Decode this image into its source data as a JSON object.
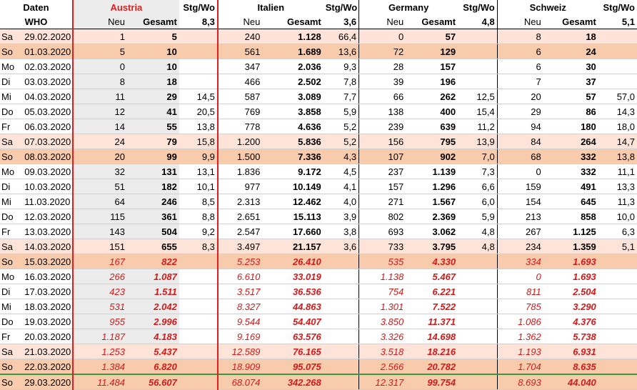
{
  "header": {
    "daten": "Daten",
    "who": "WHO",
    "neu": "Neu",
    "gesamt": "Gesamt",
    "stg": "Stg/Wo",
    "countries": [
      {
        "name": "Austria",
        "stg": "8,3"
      },
      {
        "name": "Italien",
        "stg": "3,6"
      },
      {
        "name": "Germany",
        "stg": "4,8"
      },
      {
        "name": "Schweiz",
        "stg": "5,1"
      }
    ]
  },
  "rows": [
    {
      "day": "Sa",
      "date": "29.02.2020",
      "type": "weekend",
      "c": [
        [
          "1",
          "5",
          ""
        ],
        [
          "240",
          "1.128",
          "66,4"
        ],
        [
          "0",
          "57",
          ""
        ],
        [
          "8",
          "18",
          ""
        ]
      ]
    },
    {
      "day": "So",
      "date": "01.03.2020",
      "type": "weekend2",
      "c": [
        [
          "5",
          "10",
          ""
        ],
        [
          "561",
          "1.689",
          "13,6"
        ],
        [
          "72",
          "129",
          ""
        ],
        [
          "6",
          "24",
          ""
        ]
      ]
    },
    {
      "day": "Mo",
      "date": "02.03.2020",
      "type": "wkstart",
      "c": [
        [
          "0",
          "10",
          ""
        ],
        [
          "347",
          "2.036",
          "9,3"
        ],
        [
          "28",
          "157",
          ""
        ],
        [
          "6",
          "30",
          ""
        ]
      ]
    },
    {
      "day": "Di",
      "date": "03.03.2020",
      "type": "",
      "c": [
        [
          "8",
          "18",
          ""
        ],
        [
          "466",
          "2.502",
          "7,8"
        ],
        [
          "39",
          "196",
          ""
        ],
        [
          "7",
          "37",
          ""
        ]
      ]
    },
    {
      "day": "Mi",
      "date": "04.03.2020",
      "type": "",
      "c": [
        [
          "11",
          "29",
          "14,5"
        ],
        [
          "587",
          "3.089",
          "7,7"
        ],
        [
          "66",
          "262",
          "12,5"
        ],
        [
          "20",
          "57",
          "57,0"
        ]
      ]
    },
    {
      "day": "Do",
      "date": "05.03.2020",
      "type": "",
      "c": [
        [
          "12",
          "41",
          "20,5"
        ],
        [
          "769",
          "3.858",
          "5,9"
        ],
        [
          "138",
          "400",
          "15,4"
        ],
        [
          "29",
          "86",
          "14,3"
        ]
      ]
    },
    {
      "day": "Fr",
      "date": "06.03.2020",
      "type": "",
      "c": [
        [
          "14",
          "55",
          "13,8"
        ],
        [
          "778",
          "4.636",
          "5,2"
        ],
        [
          "239",
          "639",
          "11,2"
        ],
        [
          "94",
          "180",
          "18,0"
        ]
      ]
    },
    {
      "day": "Sa",
      "date": "07.03.2020",
      "type": "weekend",
      "c": [
        [
          "24",
          "79",
          "15,8"
        ],
        [
          "1.200",
          "5.836",
          "5,2"
        ],
        [
          "156",
          "795",
          "13,9"
        ],
        [
          "84",
          "264",
          "14,7"
        ]
      ]
    },
    {
      "day": "So",
      "date": "08.03.2020",
      "type": "weekend2",
      "c": [
        [
          "20",
          "99",
          "9,9"
        ],
        [
          "1.500",
          "7.336",
          "4,3"
        ],
        [
          "107",
          "902",
          "7,0"
        ],
        [
          "68",
          "332",
          "13,8"
        ]
      ]
    },
    {
      "day": "Mo",
      "date": "09.03.2020",
      "type": "wkstart",
      "c": [
        [
          "32",
          "131",
          "13,1"
        ],
        [
          "1.836",
          "9.172",
          "4,5"
        ],
        [
          "237",
          "1.139",
          "7,3"
        ],
        [
          "0",
          "332",
          "11,1"
        ]
      ]
    },
    {
      "day": "Di",
      "date": "10.03.2020",
      "type": "",
      "c": [
        [
          "51",
          "182",
          "10,1"
        ],
        [
          "977",
          "10.149",
          "4,1"
        ],
        [
          "157",
          "1.296",
          "6,6"
        ],
        [
          "159",
          "491",
          "13,3"
        ]
      ]
    },
    {
      "day": "Mi",
      "date": "11.03.2020",
      "type": "",
      "c": [
        [
          "64",
          "246",
          "8,5"
        ],
        [
          "2.313",
          "12.462",
          "4,0"
        ],
        [
          "271",
          "1.567",
          "6,0"
        ],
        [
          "154",
          "645",
          "11,3"
        ]
      ]
    },
    {
      "day": "Do",
      "date": "12.03.2020",
      "type": "",
      "c": [
        [
          "115",
          "361",
          "8,8"
        ],
        [
          "2.651",
          "15.113",
          "3,9"
        ],
        [
          "802",
          "2.369",
          "5,9"
        ],
        [
          "213",
          "858",
          "10,0"
        ]
      ]
    },
    {
      "day": "Fr",
      "date": "13.03.2020",
      "type": "",
      "c": [
        [
          "143",
          "504",
          "9,2"
        ],
        [
          "2.547",
          "17.660",
          "3,8"
        ],
        [
          "693",
          "3.062",
          "4,8"
        ],
        [
          "267",
          "1.125",
          "6,3"
        ]
      ]
    },
    {
      "day": "Sa",
      "date": "14.03.2020",
      "type": "weekend",
      "c": [
        [
          "151",
          "655",
          "8,3"
        ],
        [
          "3.497",
          "21.157",
          "3,6"
        ],
        [
          "733",
          "3.795",
          "4,8"
        ],
        [
          "234",
          "1.359",
          "5,1"
        ]
      ]
    },
    {
      "day": "So",
      "date": "15.03.2020",
      "type": "weekend2 proj",
      "c": [
        [
          "167",
          "822",
          ""
        ],
        [
          "5.253",
          "26.410",
          ""
        ],
        [
          "535",
          "4.330",
          ""
        ],
        [
          "334",
          "1.693",
          ""
        ]
      ]
    },
    {
      "day": "Mo",
      "date": "16.03.2020",
      "type": "wkstart proj",
      "c": [
        [
          "266",
          "1.087",
          ""
        ],
        [
          "6.610",
          "33.019",
          ""
        ],
        [
          "1.138",
          "5.467",
          ""
        ],
        [
          "0",
          "1.693",
          ""
        ]
      ]
    },
    {
      "day": "Di",
      "date": "17.03.2020",
      "type": "proj",
      "c": [
        [
          "423",
          "1.511",
          ""
        ],
        [
          "3.517",
          "36.536",
          ""
        ],
        [
          "754",
          "6.221",
          ""
        ],
        [
          "811",
          "2.504",
          ""
        ]
      ]
    },
    {
      "day": "Mi",
      "date": "18.03.2020",
      "type": "proj",
      "c": [
        [
          "531",
          "2.042",
          ""
        ],
        [
          "8.327",
          "44.863",
          ""
        ],
        [
          "1.301",
          "7.522",
          ""
        ],
        [
          "785",
          "3.290",
          ""
        ]
      ]
    },
    {
      "day": "Do",
      "date": "19.03.2020",
      "type": "proj",
      "c": [
        [
          "955",
          "2.996",
          ""
        ],
        [
          "9.544",
          "54.407",
          ""
        ],
        [
          "3.850",
          "11.371",
          ""
        ],
        [
          "1.086",
          "4.376",
          ""
        ]
      ]
    },
    {
      "day": "Fr",
      "date": "20.03.2020",
      "type": "proj",
      "c": [
        [
          "1.187",
          "4.183",
          ""
        ],
        [
          "9.169",
          "63.576",
          ""
        ],
        [
          "3.326",
          "14.698",
          ""
        ],
        [
          "1.362",
          "5.738",
          ""
        ]
      ]
    },
    {
      "day": "Sa",
      "date": "21.03.2020",
      "type": "weekend proj",
      "c": [
        [
          "1.253",
          "5.437",
          ""
        ],
        [
          "12.589",
          "76.165",
          ""
        ],
        [
          "3.518",
          "18.216",
          ""
        ],
        [
          "1.193",
          "6.931",
          ""
        ]
      ]
    },
    {
      "day": "So",
      "date": "22.03.2020",
      "type": "weekend2 proj",
      "c": [
        [
          "1.384",
          "6.820",
          ""
        ],
        [
          "18.909",
          "95.075",
          ""
        ],
        [
          "2.566",
          "20.782",
          ""
        ],
        [
          "1.704",
          "8.635",
          ""
        ]
      ]
    },
    {
      "day": "So",
      "date": "29.03.2020",
      "type": "total proj",
      "c": [
        [
          "11.484",
          "56.607",
          ""
        ],
        [
          "68.074",
          "342.268",
          ""
        ],
        [
          "12.317",
          "99.754",
          ""
        ],
        [
          "8.693",
          "44.040",
          ""
        ]
      ]
    }
  ]
}
